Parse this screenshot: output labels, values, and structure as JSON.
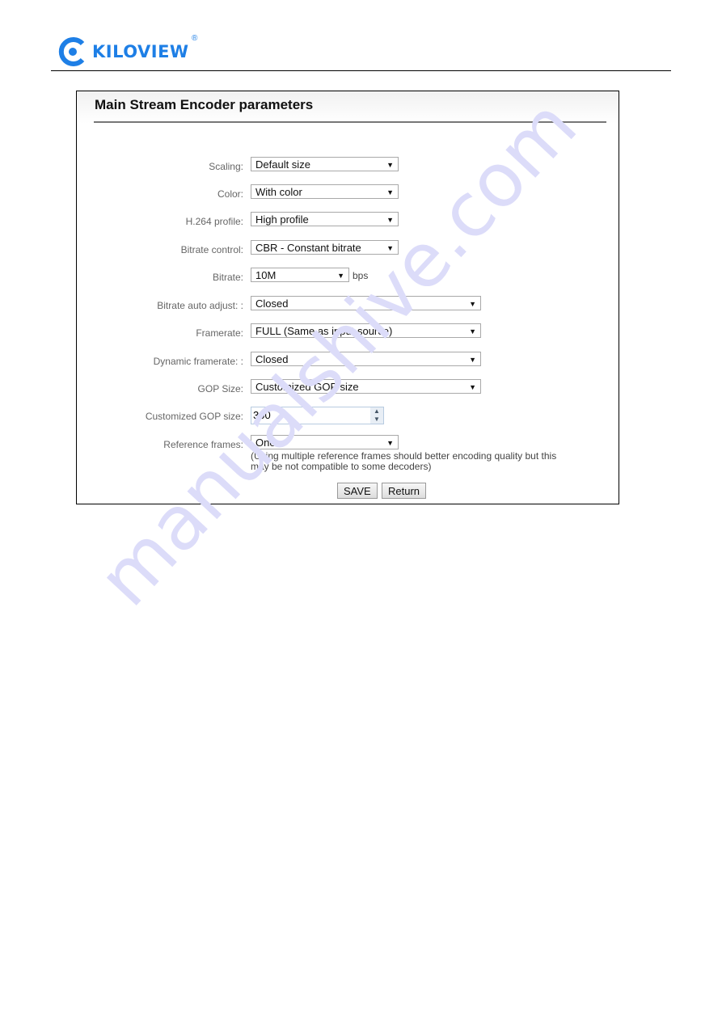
{
  "header": {
    "logo_text": "KILOVIEW",
    "logo_reg": "®",
    "brand_color": "#1e7fe6"
  },
  "panel": {
    "title": "Main Stream Encoder parameters",
    "fields": [
      {
        "label": "Scaling:",
        "value": "Default size"
      },
      {
        "label": "Color:",
        "value": "With color"
      },
      {
        "label": "H.264 profile:",
        "value": "High profile"
      },
      {
        "label": "Bitrate control:",
        "value": "CBR - Constant bitrate"
      },
      {
        "label": "Bitrate:",
        "value": "10M",
        "unit": "bps"
      },
      {
        "label": "Bitrate auto adjust: :",
        "value": "Closed"
      },
      {
        "label": "Framerate:",
        "value": "FULL (Same as input source)"
      },
      {
        "label": "Dynamic framerate: :",
        "value": "Closed"
      },
      {
        "label": "GOP Size:",
        "value": "Customized GOP size"
      },
      {
        "label": "Customized GOP size:",
        "value": "300"
      },
      {
        "label": "Reference frames:",
        "value": "One",
        "hint": "(Using multiple reference frames should better encoding quality but this may be not compatible to some decoders)"
      }
    ],
    "save_label": "SAVE",
    "return_label": "Return"
  },
  "watermark": "manualshive.com"
}
